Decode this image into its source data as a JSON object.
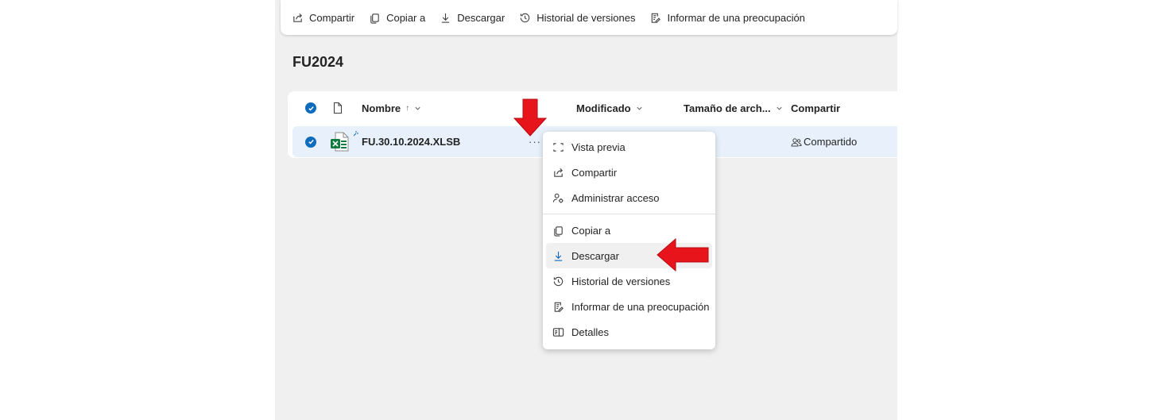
{
  "toolbar": {
    "items": [
      {
        "label": "Compartir",
        "icon": "share-icon"
      },
      {
        "label": "Copiar a",
        "icon": "copy-icon"
      },
      {
        "label": "Descargar",
        "icon": "download-icon"
      },
      {
        "label": "Historial de versiones",
        "icon": "history-icon"
      },
      {
        "label": "Informar de una preocupación",
        "icon": "report-icon"
      }
    ]
  },
  "folder": {
    "title": "FU2024"
  },
  "list": {
    "columns": {
      "name": "Nombre",
      "name_sort": "↑",
      "modified": "Modificado",
      "size": "Tamaño de arch...",
      "sharing": "Compartir"
    },
    "rows": [
      {
        "name": "FU.30.10.2024.XLSB",
        "more": "···",
        "sharing": "Compartido",
        "file_type": "excel-file-icon",
        "selected": true
      }
    ]
  },
  "context_menu": {
    "group1": [
      {
        "label": "Vista previa",
        "icon": "preview-icon"
      },
      {
        "label": "Compartir",
        "icon": "share-icon"
      },
      {
        "label": "Administrar acceso",
        "icon": "manage-access-icon"
      }
    ],
    "group2": [
      {
        "label": "Copiar a",
        "icon": "copy-icon"
      },
      {
        "label": "Descargar",
        "icon": "download-icon",
        "highlighted": true
      },
      {
        "label": "Historial de versiones",
        "icon": "history-icon"
      },
      {
        "label": "Informar de una preocupación",
        "icon": "report-icon"
      },
      {
        "label": "Detalles",
        "icon": "details-icon"
      }
    ]
  },
  "colors": {
    "accent": "#0f6cbd",
    "annotation_arrow": "#e8141c",
    "selected_row": "#e8f1fb",
    "excel_green": "#107c41"
  }
}
